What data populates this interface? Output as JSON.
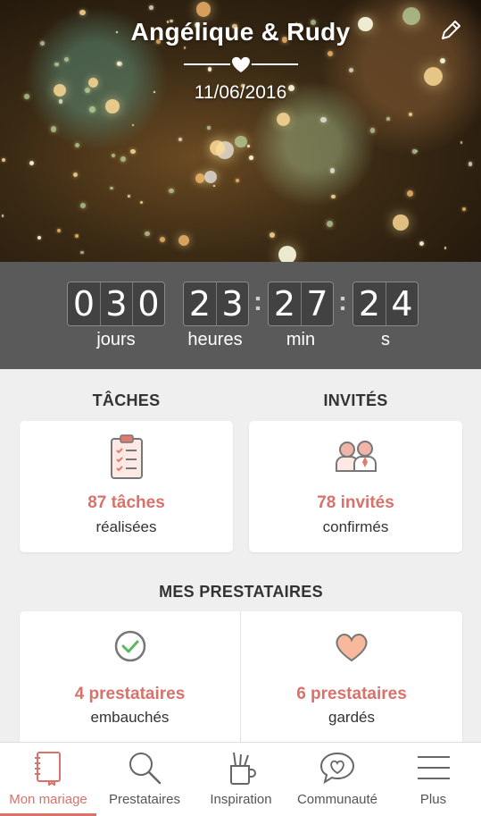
{
  "header": {
    "couple_names": "Angélique & Rudy",
    "date": "11/06/2016"
  },
  "countdown": {
    "days": [
      "0",
      "3",
      "0"
    ],
    "hours": [
      "2",
      "3"
    ],
    "minutes": [
      "2",
      "7"
    ],
    "seconds": [
      "2",
      "4"
    ],
    "labels": {
      "days": "jours",
      "hours": "heures",
      "minutes": "min",
      "seconds": "s"
    }
  },
  "sections": {
    "tasks_title": "TÂCHES",
    "guests_title": "INVITÉS",
    "vendors_title": "MES PRESTATAIRES"
  },
  "cards": {
    "tasks": {
      "main": "87 tâches",
      "sub": "réalisées"
    },
    "guests": {
      "main": "78 invités",
      "sub": "confirmés"
    },
    "hired": {
      "main": "4 prestataires",
      "sub": "embauchés"
    },
    "saved": {
      "main": "6 prestataires",
      "sub": "gardés"
    }
  },
  "nav": {
    "items": [
      {
        "label": "Mon mariage",
        "icon": "notebook-icon"
      },
      {
        "label": "Prestataires",
        "icon": "search-icon"
      },
      {
        "label": "Inspiration",
        "icon": "pencil-cup-icon"
      },
      {
        "label": "Communauté",
        "icon": "chat-heart-icon"
      },
      {
        "label": "Plus",
        "icon": "menu-icon"
      }
    ]
  },
  "colors": {
    "accent": "#d9726a",
    "countdown_bg": "#5a5a5a",
    "digit_bg": "#424242"
  }
}
